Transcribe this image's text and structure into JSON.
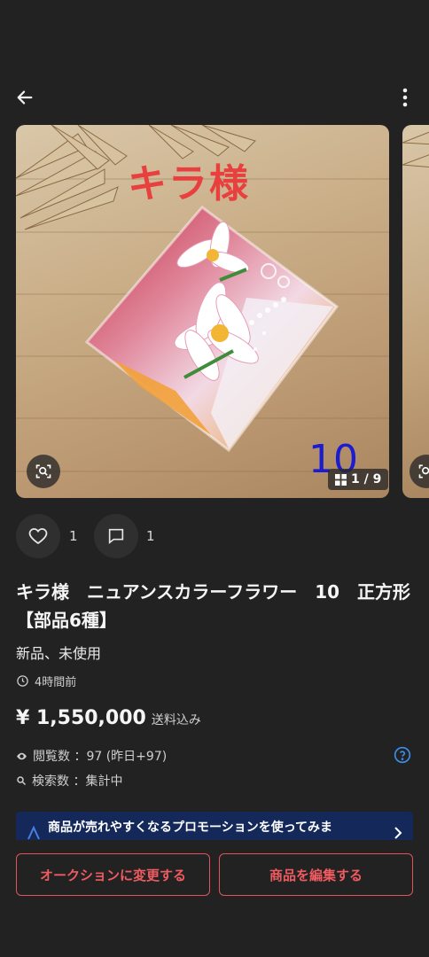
{
  "colors": {
    "accent": "#e0535a",
    "banner": "#14295a",
    "help": "#3b8ee8",
    "overlay_red": "#e8403e",
    "overlay_blue": "#1b1cd1"
  },
  "topbar": {
    "back_icon": "arrow-left-icon",
    "menu_icon": "more-vertical-icon"
  },
  "image": {
    "overlay_title": "キラ様",
    "overlay_number": "10",
    "counter": "1 / 9",
    "counter_icon": "grid-icon",
    "lens_icon": "image-search-icon"
  },
  "social": {
    "likes": "1",
    "comments": "1"
  },
  "item": {
    "title": "キラ様　ニュアンスカラーフラワー　10　正方形【部品6種】",
    "condition": "新品、未使用",
    "posted": "4時間前",
    "price": "¥ 1,550,000",
    "shipping": "送料込み"
  },
  "stats": {
    "views_label": "閲覧数 ：97 (昨日+97)",
    "search_label": "検索数 ：集計中"
  },
  "promo": {
    "text": "商品が売れやすくなるプロモーションを使ってみま"
  },
  "actions": {
    "auction": "オークションに変更する",
    "edit": "商品を編集する"
  }
}
